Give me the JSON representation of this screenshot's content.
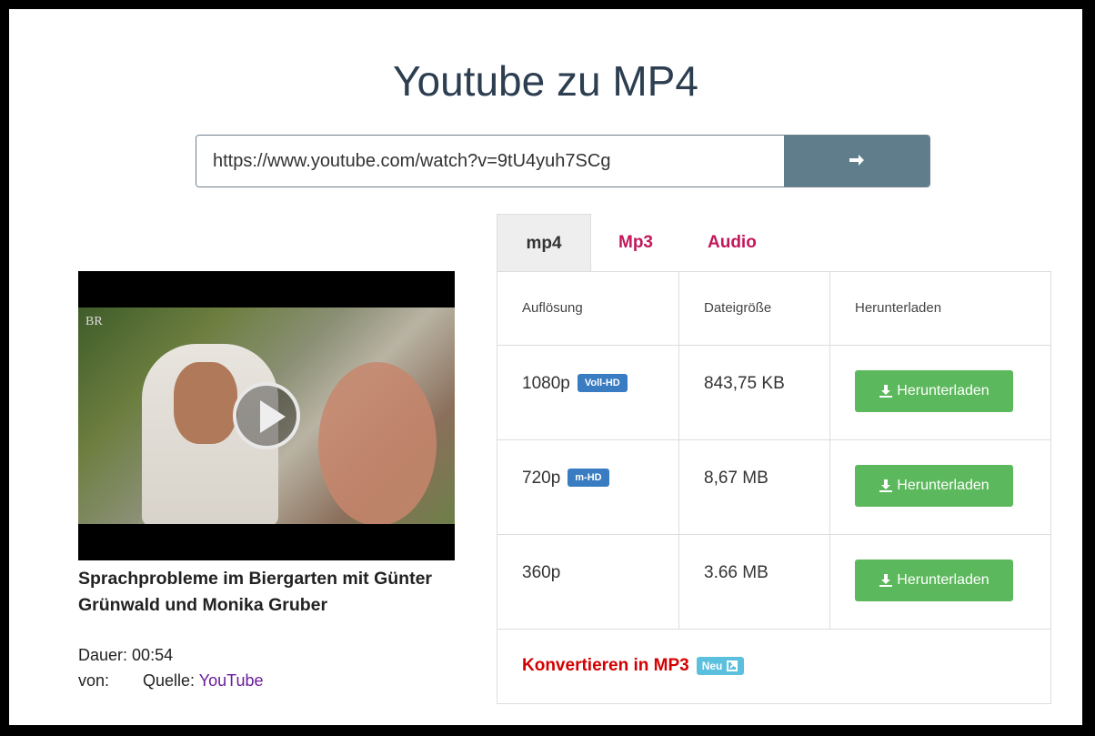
{
  "page": {
    "title": "Youtube zu MP4"
  },
  "search": {
    "value": "https://www.youtube.com/watch?v=9tU4yuh7SCg",
    "submit_icon": "arrow-right-icon"
  },
  "video": {
    "channel_logo": "BR",
    "title": "Sprachprobleme im Biergarten mit Günter Grünwald und Monika Gruber",
    "duration_label": "Dauer:",
    "duration": "00:54",
    "by_label": "von:",
    "source_label": "Quelle:",
    "source_link": "YouTube"
  },
  "tabs": [
    {
      "label": "mp4",
      "active": true
    },
    {
      "label": "Mp3",
      "active": false
    },
    {
      "label": "Audio",
      "active": false
    }
  ],
  "table": {
    "headers": [
      "Auflösung",
      "Dateigröße",
      "Herunterladen"
    ],
    "rows": [
      {
        "resolution": "1080p",
        "badge": "Voll-HD",
        "size": "843,75 KB",
        "button": "Herunterladen"
      },
      {
        "resolution": "720p",
        "badge": "m-HD",
        "size": "8,67 MB",
        "button": "Herunterladen"
      },
      {
        "resolution": "360p",
        "badge": "",
        "size": "3.66 MB",
        "button": "Herunterladen"
      }
    ]
  },
  "convert": {
    "label": "Konvertieren in MP3",
    "badge": "Neu"
  },
  "colors": {
    "accent_red": "#c2185b",
    "download_green": "#5cb85c",
    "badge_blue": "#3a7cc1",
    "go_button": "#607d8b"
  }
}
